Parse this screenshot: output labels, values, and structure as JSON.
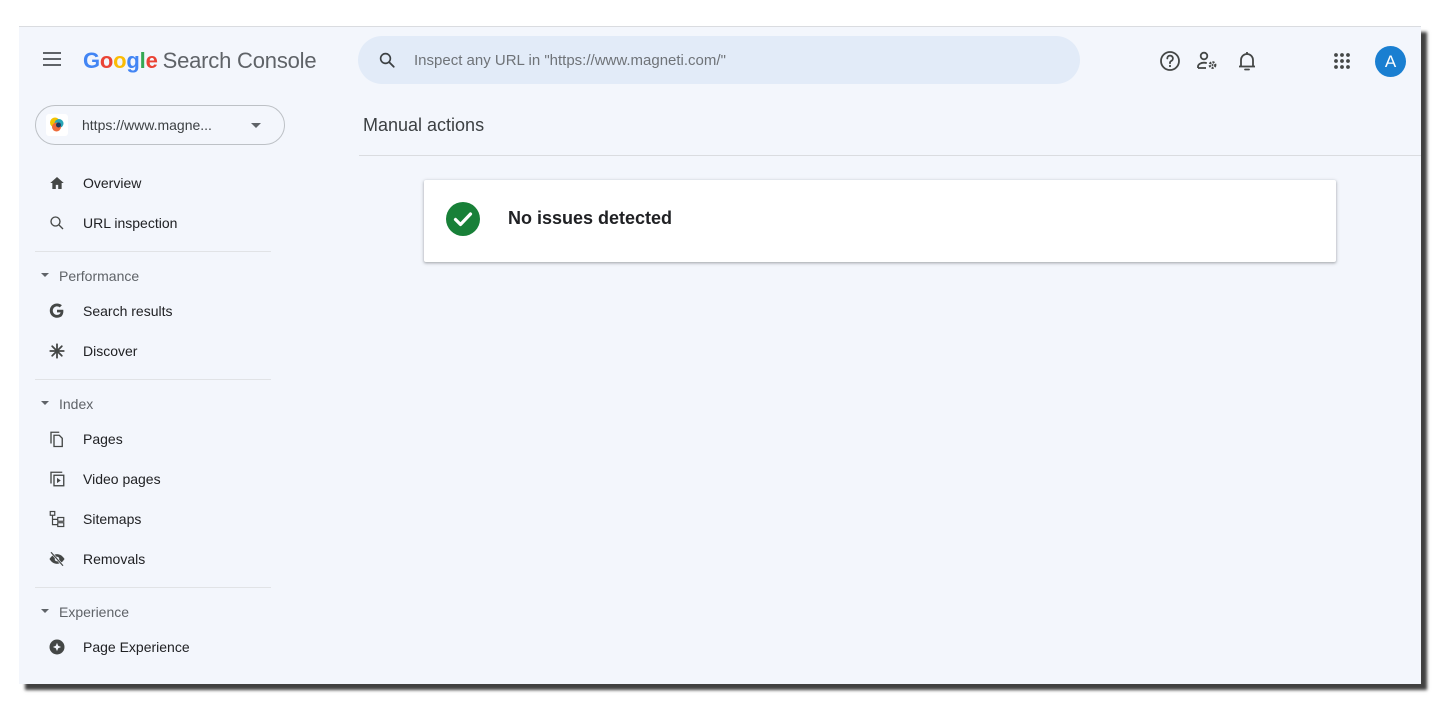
{
  "header": {
    "logo_letters": [
      "G",
      "o",
      "o",
      "g",
      "l",
      "e"
    ],
    "product_name": "Search Console",
    "search_placeholder": "Inspect any URL in \"https://www.magneti.com/\"",
    "icons": [
      "help-icon",
      "manage-users-icon",
      "notifications-icon",
      "apps-icon"
    ],
    "avatar_initial": "A",
    "avatar_color": "#1a7fd1"
  },
  "property": {
    "label": "https://www.magne..."
  },
  "sidebar": {
    "top_items": [
      {
        "label": "Overview",
        "icon": "home-icon"
      },
      {
        "label": "URL inspection",
        "icon": "search-icon"
      }
    ],
    "sections": [
      {
        "title": "Performance",
        "items": [
          {
            "label": "Search results",
            "icon": "google-g-icon"
          },
          {
            "label": "Discover",
            "icon": "asterisk-icon"
          }
        ]
      },
      {
        "title": "Index",
        "items": [
          {
            "label": "Pages",
            "icon": "pages-icon"
          },
          {
            "label": "Video pages",
            "icon": "video-pages-icon"
          },
          {
            "label": "Sitemaps",
            "icon": "sitemap-icon"
          },
          {
            "label": "Removals",
            "icon": "removals-icon"
          }
        ]
      },
      {
        "title": "Experience",
        "items": [
          {
            "label": "Page Experience",
            "icon": "page-experience-icon"
          }
        ]
      }
    ]
  },
  "main": {
    "title": "Manual actions",
    "status": {
      "message": "No issues detected",
      "color": "#188038"
    }
  }
}
